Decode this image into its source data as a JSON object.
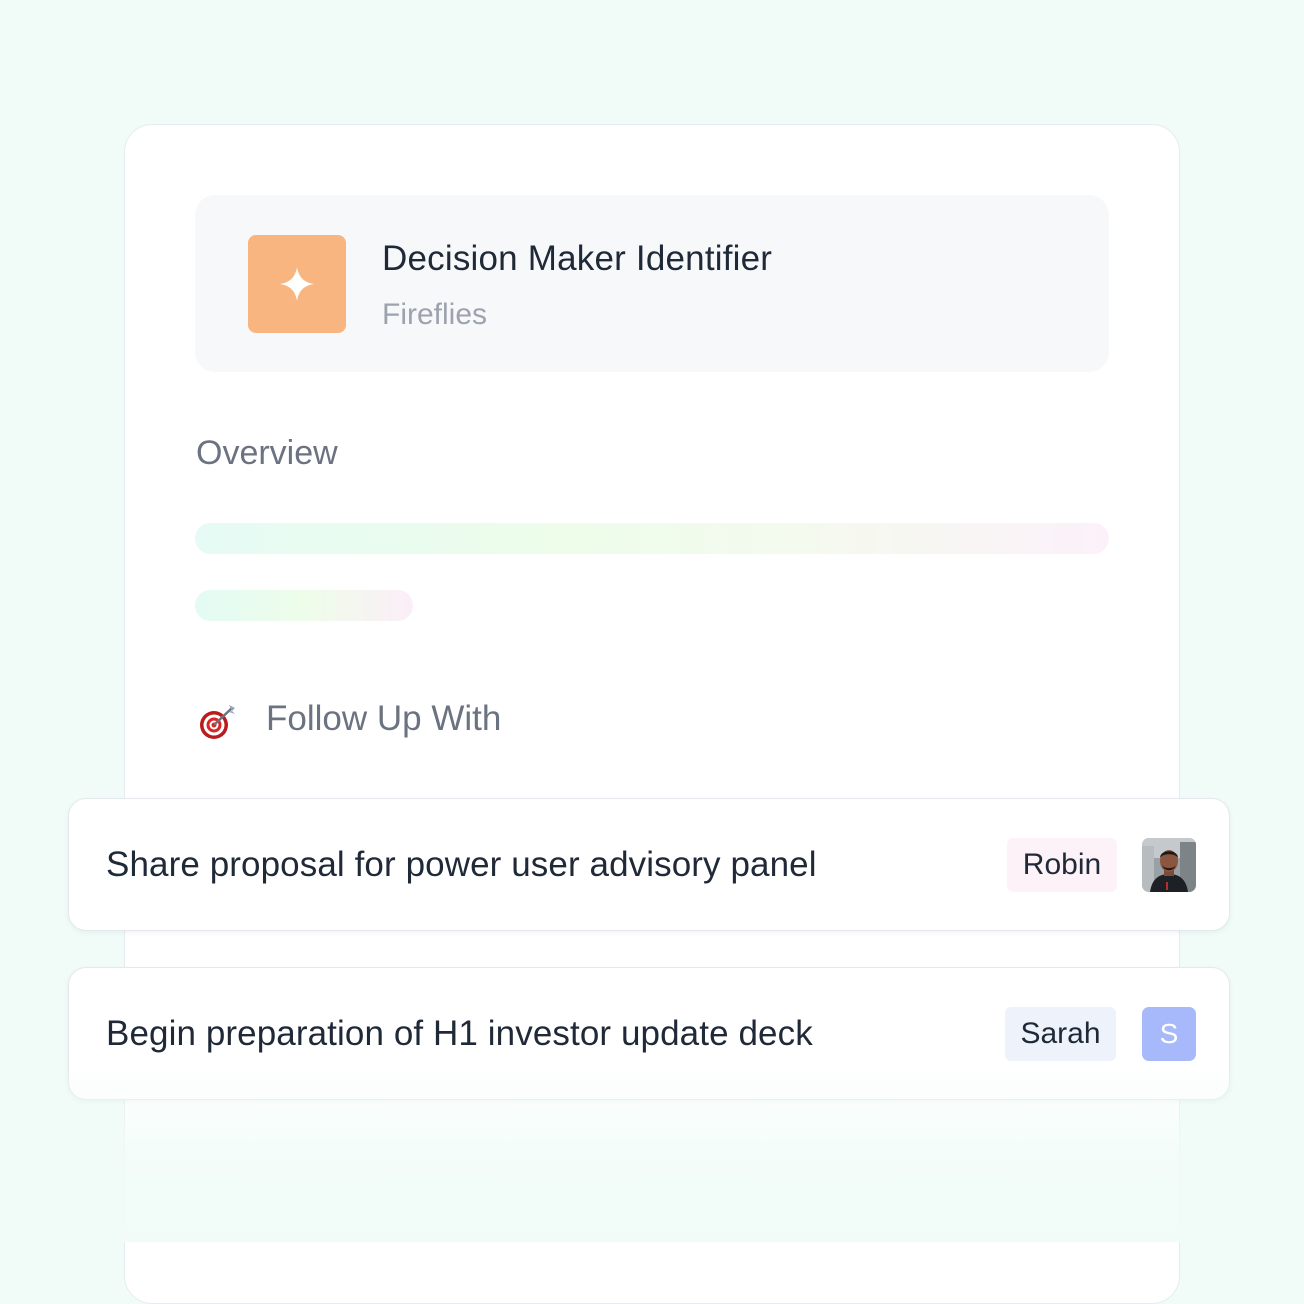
{
  "agent": {
    "title": "Decision Maker Identifier",
    "source": "Fireflies",
    "icon": "sparkle-icon",
    "icon_tile_color": "#f8b57f"
  },
  "overview": {
    "label": "Overview"
  },
  "follow_up": {
    "label": "Follow Up With",
    "icon": "target-dart-icon"
  },
  "tasks": [
    {
      "text": "Share proposal for power user advisory panel",
      "assignee": "Robin",
      "avatar": "person-photo",
      "chip_color": "#fdf2f8"
    },
    {
      "text": "Begin preparation of H1 investor update deck",
      "assignee": "Sarah",
      "avatar_initial": "S",
      "avatar_color": "#a7b9fb",
      "chip_color": "#eef2fb"
    }
  ]
}
